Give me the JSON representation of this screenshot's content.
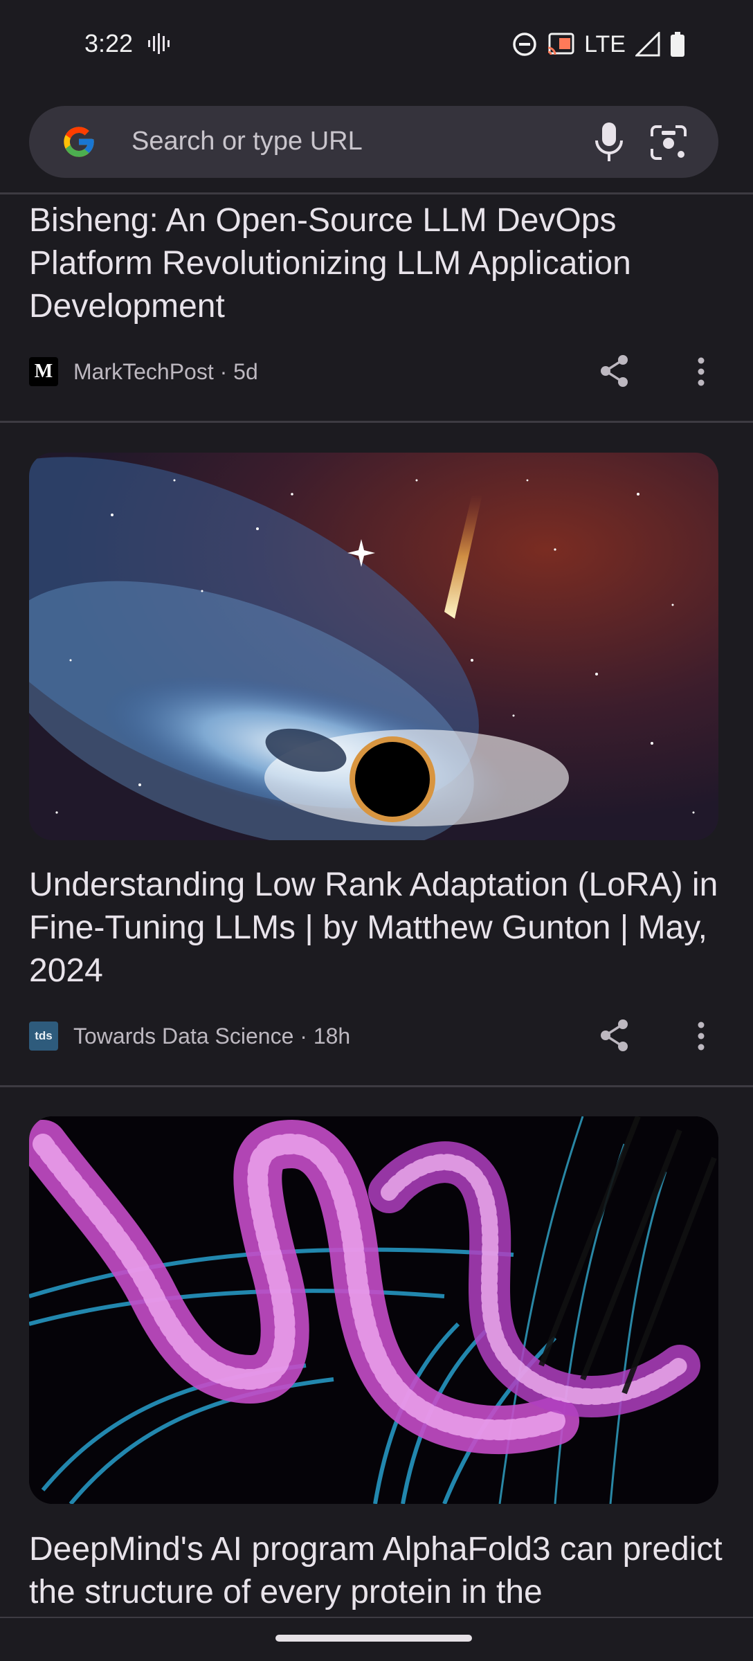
{
  "status_bar": {
    "time": "3:22",
    "network": "LTE",
    "icons": [
      "vibrate-icon",
      "dnd-icon",
      "cast-icon",
      "signal-icon",
      "battery-icon"
    ]
  },
  "search": {
    "placeholder": "Search or type URL",
    "icons": [
      "google-logo",
      "mic-icon",
      "lens-icon"
    ]
  },
  "feed": {
    "articles": [
      {
        "title": "Bisheng: An Open-Source LLM DevOps Platform Revolutionizing LLM Application Development",
        "source_logo_text": "M",
        "source": "MarkTechPost · 5d"
      },
      {
        "title": "Understanding Low Rank Adaptation (LoRA) in Fine-Tuning LLMs | by Matthew Gunton | May, 2024",
        "source_logo_text": "tds",
        "source": "Towards Data Science · 18h",
        "image": "black-hole-galaxy-image"
      },
      {
        "title": "DeepMind's AI program AlphaFold3 can predict the structure of every protein in the",
        "image": "protein-structure-image"
      }
    ]
  },
  "colors": {
    "background": "#1c1b20",
    "search_bg": "#35333c",
    "text": "#e8e3ea",
    "meta_text": "#bdb8c0"
  }
}
